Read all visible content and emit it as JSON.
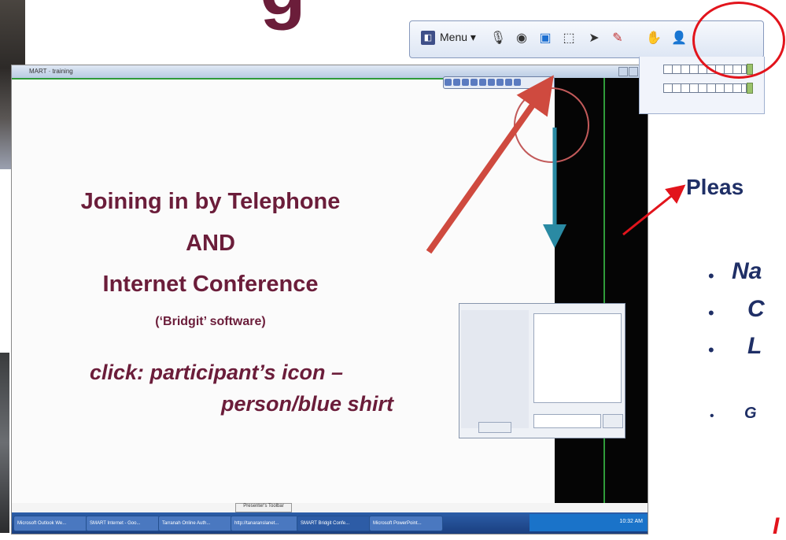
{
  "slide": {
    "title_fragment": "g",
    "left_block": {
      "line1": "Joining in by Telephone",
      "line2": "AND",
      "line3": "Internet Conference",
      "line4": "(‘Bridgit’ software)",
      "click_line1": "click: participant’s icon –",
      "click_line2": "person/blue shirt"
    },
    "right_block": {
      "please": "Pleas",
      "bullets": [
        {
          "bullet": "•",
          "text": "Na"
        },
        {
          "bullet": "•",
          "text": "C"
        },
        {
          "bullet": "•",
          "text": "L"
        },
        {
          "bullet": "•",
          "text": "G"
        }
      ],
      "trailing_fragment": "I"
    }
  },
  "toolbar": {
    "menu_label": "Menu ▾",
    "icons": [
      "app-icon",
      "microphone-icon",
      "webcam-icon",
      "monitor-share-icon",
      "select-region-icon",
      "pointer-icon",
      "pen-icon",
      "raise-hand-icon",
      "participant-icon"
    ]
  },
  "inner_screenshot": {
    "window_title": "MART · training",
    "tab_label": "Presenter's Toolbar",
    "taskbar_items": [
      "Microsoft Outlook We...",
      "SMART Internet - Goo...",
      "Tarranah Online Auth...",
      "http://tanaranslanet...",
      "SMART Bridgit Confe...",
      "Microsoft PowerPoint..."
    ],
    "clock": "10:32 AM"
  },
  "colors": {
    "maroon": "#6b1d3a",
    "navy": "#1f2f66",
    "highlight_red": "#e2141c",
    "arrow_red": "#cf4a3f",
    "arrow_teal": "#2a8aa3"
  }
}
